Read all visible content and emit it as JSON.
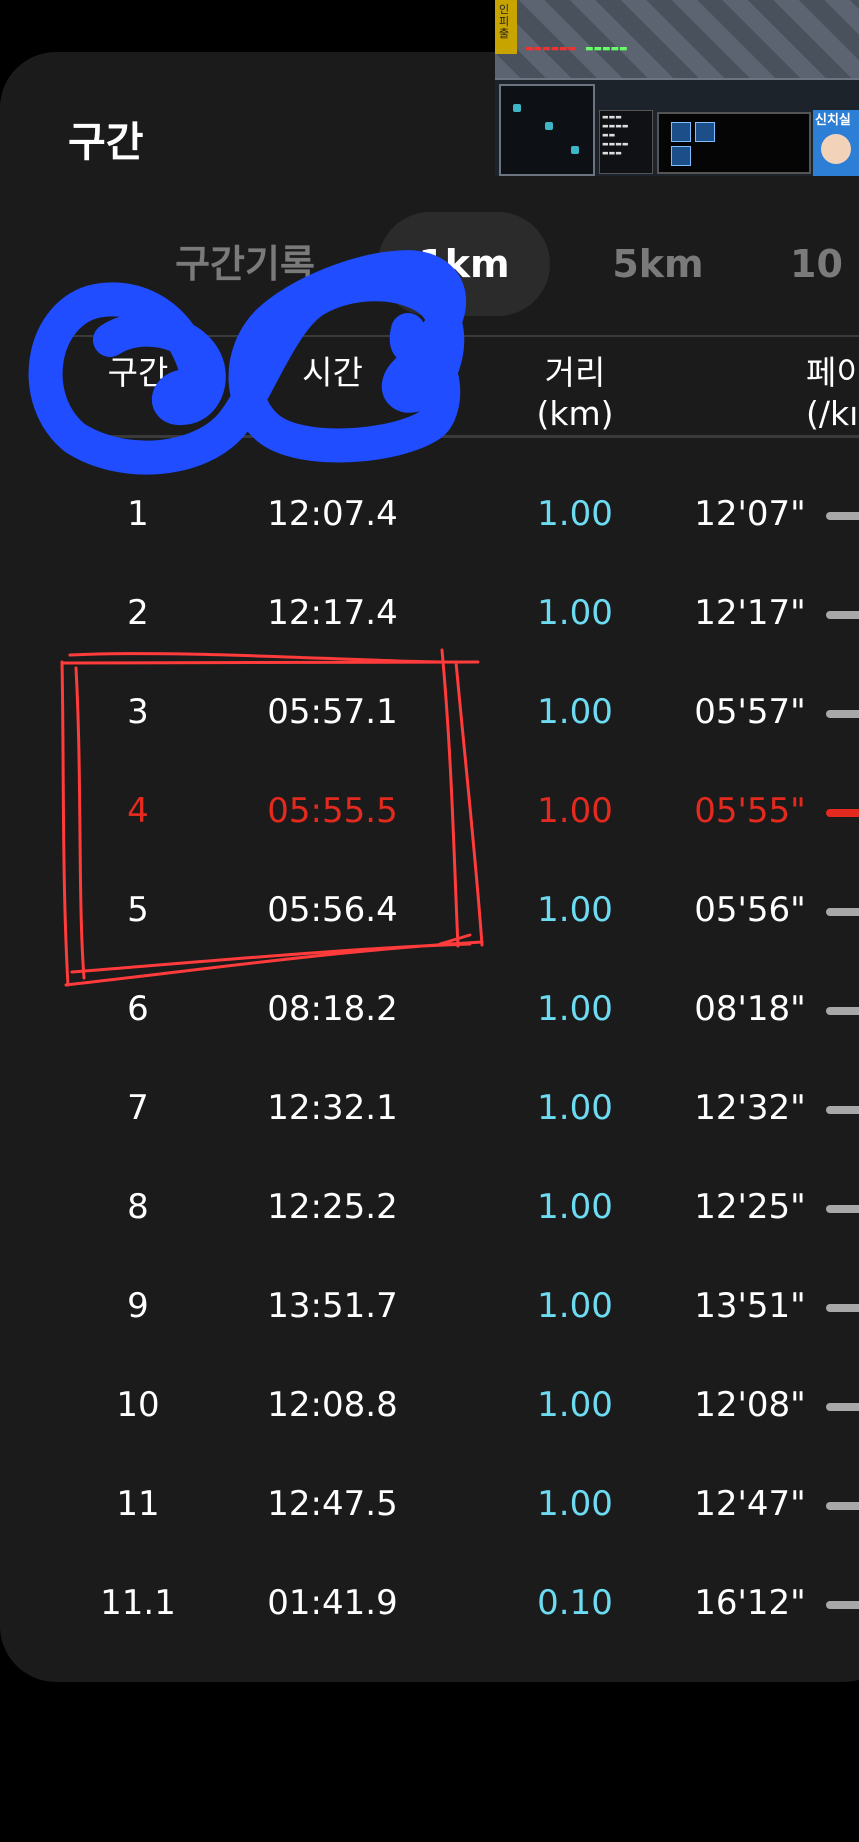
{
  "section": {
    "title": "구간"
  },
  "tabs": [
    {
      "label": "구간기록",
      "active": false
    },
    {
      "label": "1km",
      "active": true
    },
    {
      "label": "5km",
      "active": false
    },
    {
      "label": "10",
      "active": false
    }
  ],
  "columns": {
    "segment": "구간",
    "time": "시간",
    "distance": "거리",
    "distance_unit": "(km)",
    "pace": "페이",
    "pace_unit": "(/kı"
  },
  "rows": [
    {
      "segment": "1",
      "time": "12:07.4",
      "distance": "1.00",
      "pace": "12'07\"",
      "best": false
    },
    {
      "segment": "2",
      "time": "12:17.4",
      "distance": "1.00",
      "pace": "12'17\"",
      "best": false
    },
    {
      "segment": "3",
      "time": "05:57.1",
      "distance": "1.00",
      "pace": "05'57\"",
      "best": false
    },
    {
      "segment": "4",
      "time": "05:55.5",
      "distance": "1.00",
      "pace": "05'55\"",
      "best": true
    },
    {
      "segment": "5",
      "time": "05:56.4",
      "distance": "1.00",
      "pace": "05'56\"",
      "best": false
    },
    {
      "segment": "6",
      "time": "08:18.2",
      "distance": "1.00",
      "pace": "08'18\"",
      "best": false
    },
    {
      "segment": "7",
      "time": "12:32.1",
      "distance": "1.00",
      "pace": "12'32\"",
      "best": false
    },
    {
      "segment": "8",
      "time": "12:25.2",
      "distance": "1.00",
      "pace": "12'25\"",
      "best": false
    },
    {
      "segment": "9",
      "time": "13:51.7",
      "distance": "1.00",
      "pace": "13'51\"",
      "best": false
    },
    {
      "segment": "10",
      "time": "12:08.8",
      "distance": "1.00",
      "pace": "12'08\"",
      "best": false
    },
    {
      "segment": "11",
      "time": "12:47.5",
      "distance": "1.00",
      "pace": "12'47\"",
      "best": false
    },
    {
      "segment": "11.1",
      "time": "01:41.9",
      "distance": "0.10",
      "pace": "16'12\"",
      "best": false
    }
  ],
  "overlay": {
    "strip_text": "인피 출",
    "portrait_text": "신치실"
  },
  "colors": {
    "background": "#000000",
    "card": "#1b1b1b",
    "distance": "#6ddcf2",
    "best": "#e42a1f",
    "annotation_blue": "#1f4dff",
    "annotation_red": "#ff3b3b"
  }
}
